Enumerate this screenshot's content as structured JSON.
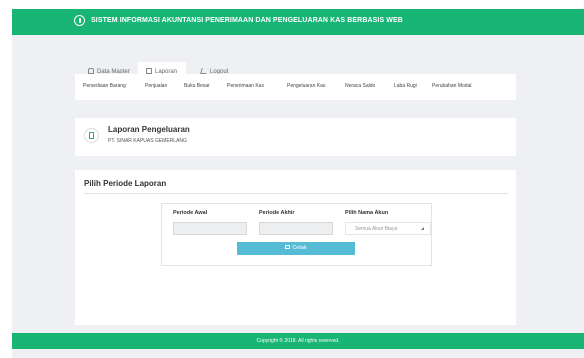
{
  "app": {
    "title": "SISTEM INFORMASI AKUNTANSI PENERIMAAN DAN PENGELUARAN KAS BERBASIS WEB"
  },
  "tabs": [
    {
      "label": "Data Master",
      "icon": "home-icon"
    },
    {
      "label": "Laporan",
      "icon": "document-icon",
      "active": true
    },
    {
      "label": "Logout",
      "icon": "logout-icon"
    }
  ],
  "subnav": [
    "Persediaan Barang",
    "Penjualan",
    "Buku Besar",
    "Penerimaan Kas",
    "Pengeluaran Kas",
    "Neraca Saldo",
    "Laba Rugi",
    "Perubahan Modal"
  ],
  "page": {
    "title": "Laporan Pengeluaran",
    "subtitle": "PT. SINAR KAPUAS GEMERLANG"
  },
  "panel": {
    "title": "Pilih Periode Laporan",
    "periode_awal_label": "Periode Awal",
    "periode_awal_value": "",
    "periode_akhir_label": "Periode Akhir",
    "periode_akhir_value": "",
    "akun_label": "Pilih Nama Akun",
    "akun_value": "Semua Akun Biaya",
    "cetak_label": "Cetak"
  },
  "footer": {
    "text": "Copyright © 2018. All rights reserved."
  },
  "colors": {
    "primary": "#18b575",
    "button": "#56bcd6",
    "background": "#eef0f3"
  }
}
